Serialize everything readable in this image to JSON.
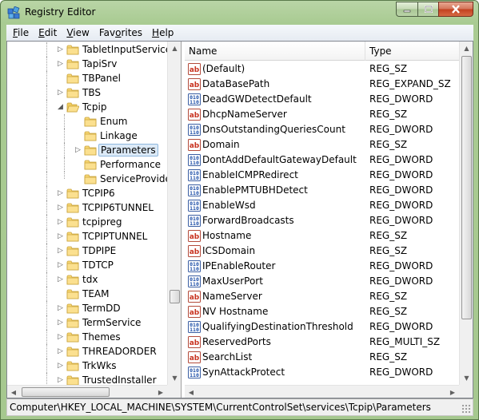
{
  "window": {
    "title": "Registry Editor"
  },
  "menu": [
    {
      "u": "F",
      "rest": "ile"
    },
    {
      "u": "E",
      "rest": "dit"
    },
    {
      "u": "V",
      "rest": "iew"
    },
    {
      "u": "",
      "rest": "Favorites",
      "u_mid": "a"
    },
    {
      "u": "H",
      "rest": "elp"
    }
  ],
  "tree": {
    "items": [
      {
        "label": "TabletInputService",
        "level": 0,
        "expander": "collapsed"
      },
      {
        "label": "TapiSrv",
        "level": 0,
        "expander": "collapsed"
      },
      {
        "label": "TBPanel",
        "level": 0,
        "expander": "none"
      },
      {
        "label": "TBS",
        "level": 0,
        "expander": "collapsed"
      },
      {
        "label": "Tcpip",
        "level": 0,
        "expander": "expanded"
      },
      {
        "label": "Enum",
        "level": 1,
        "expander": "none"
      },
      {
        "label": "Linkage",
        "level": 1,
        "expander": "none"
      },
      {
        "label": "Parameters",
        "level": 1,
        "expander": "collapsed",
        "selected": true
      },
      {
        "label": "Performance",
        "level": 1,
        "expander": "none"
      },
      {
        "label": "ServiceProvider",
        "level": 1,
        "expander": "none"
      },
      {
        "label": "TCPIP6",
        "level": 0,
        "expander": "collapsed"
      },
      {
        "label": "TCPIP6TUNNEL",
        "level": 0,
        "expander": "collapsed"
      },
      {
        "label": "tcpipreg",
        "level": 0,
        "expander": "collapsed"
      },
      {
        "label": "TCPIPTUNNEL",
        "level": 0,
        "expander": "collapsed"
      },
      {
        "label": "TDPIPE",
        "level": 0,
        "expander": "collapsed"
      },
      {
        "label": "TDTCP",
        "level": 0,
        "expander": "collapsed"
      },
      {
        "label": "tdx",
        "level": 0,
        "expander": "collapsed"
      },
      {
        "label": "TEAM",
        "level": 0,
        "expander": "none"
      },
      {
        "label": "TermDD",
        "level": 0,
        "expander": "collapsed"
      },
      {
        "label": "TermService",
        "level": 0,
        "expander": "collapsed"
      },
      {
        "label": "Themes",
        "level": 0,
        "expander": "collapsed"
      },
      {
        "label": "THREADORDER",
        "level": 0,
        "expander": "collapsed"
      },
      {
        "label": "TrkWks",
        "level": 0,
        "expander": "collapsed"
      },
      {
        "label": "TrustedInstaller",
        "level": 0,
        "expander": "collapsed"
      }
    ]
  },
  "list": {
    "columns": {
      "name": "Name",
      "type": "Type"
    },
    "rows": [
      {
        "icon": "string-value-icon",
        "name": "(Default)",
        "type": "REG_SZ"
      },
      {
        "icon": "string-value-icon",
        "name": "DataBasePath",
        "type": "REG_EXPAND_SZ"
      },
      {
        "icon": "binary-value-icon",
        "name": "DeadGWDetectDefault",
        "type": "REG_DWORD"
      },
      {
        "icon": "string-value-icon",
        "name": "DhcpNameServer",
        "type": "REG_SZ"
      },
      {
        "icon": "binary-value-icon",
        "name": "DnsOutstandingQueriesCount",
        "type": "REG_DWORD"
      },
      {
        "icon": "string-value-icon",
        "name": "Domain",
        "type": "REG_SZ"
      },
      {
        "icon": "binary-value-icon",
        "name": "DontAddDefaultGatewayDefault",
        "type": "REG_DWORD"
      },
      {
        "icon": "binary-value-icon",
        "name": "EnableICMPRedirect",
        "type": "REG_DWORD"
      },
      {
        "icon": "binary-value-icon",
        "name": "EnablePMTUBHDetect",
        "type": "REG_DWORD"
      },
      {
        "icon": "binary-value-icon",
        "name": "EnableWsd",
        "type": "REG_DWORD"
      },
      {
        "icon": "binary-value-icon",
        "name": "ForwardBroadcasts",
        "type": "REG_DWORD"
      },
      {
        "icon": "string-value-icon",
        "name": "Hostname",
        "type": "REG_SZ"
      },
      {
        "icon": "string-value-icon",
        "name": "ICSDomain",
        "type": "REG_SZ"
      },
      {
        "icon": "binary-value-icon",
        "name": "IPEnableRouter",
        "type": "REG_DWORD"
      },
      {
        "icon": "binary-value-icon",
        "name": "MaxUserPort",
        "type": "REG_DWORD"
      },
      {
        "icon": "string-value-icon",
        "name": "NameServer",
        "type": "REG_SZ"
      },
      {
        "icon": "string-value-icon",
        "name": "NV Hostname",
        "type": "REG_SZ"
      },
      {
        "icon": "binary-value-icon",
        "name": "QualifyingDestinationThreshold",
        "type": "REG_DWORD"
      },
      {
        "icon": "string-value-icon",
        "name": "ReservedPorts",
        "type": "REG_MULTI_SZ"
      },
      {
        "icon": "string-value-icon",
        "name": "SearchList",
        "type": "REG_SZ"
      },
      {
        "icon": "binary-value-icon",
        "name": "SynAttackProtect",
        "type": "REG_DWORD"
      }
    ]
  },
  "status": {
    "path": "Computer\\HKEY_LOCAL_MACHINE\\SYSTEM\\CurrentControlSet\\services\\Tcpip\\Parameters"
  }
}
